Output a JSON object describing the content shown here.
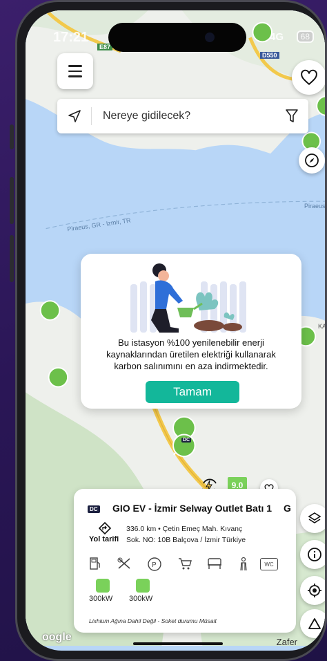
{
  "status_bar": {
    "time": "17:21",
    "network": "4G",
    "battery": "68"
  },
  "map": {
    "road_labels": [
      "E87",
      "D550"
    ],
    "sea_route_labels": [
      "Piraeus, GR - Izmir, TR",
      "Piraeus"
    ],
    "place_labels": [
      "KAR",
      "Zafer"
    ],
    "google_logo": "oogle"
  },
  "search": {
    "placeholder": "Nereye gidilecek?"
  },
  "modal": {
    "message": "Bu istasyon %100 yenilenebilir enerji kaynaklarından üretilen elektriği kullanarak karbon salınımını en aza indirmektedir.",
    "ok_label": "Tamam"
  },
  "station_card": {
    "tag": "DC",
    "title": "GIO EV - İzmir Selway Outlet Batı 1",
    "next_title_peek": "G",
    "route_label": "Yol tarifi",
    "address_line1": "336.0 km • Çetin Emeç Mah. Kıvanç",
    "address_line2": "Sok. NO: 10B Balçova / İzmir Türkiye",
    "rating": "9.0",
    "chargers": [
      {
        "power": "300kW"
      },
      {
        "power": "300kW"
      }
    ],
    "amenity_icons": [
      "fuel-icon",
      "restaurant-icon",
      "parking-icon",
      "shopping-icon",
      "seating-icon",
      "restroom-person-icon",
      "wc-icon"
    ],
    "wc_label": "WC",
    "footer": "Lixhium Ağına Dahil Değil - Soket durumu Müsait"
  },
  "map_pin": {
    "tag": "DC"
  },
  "colors": {
    "accent": "#13b79a",
    "pin_green": "#6cc04a",
    "map_water": "#b8d6f7",
    "map_land": "#eef0ec"
  }
}
